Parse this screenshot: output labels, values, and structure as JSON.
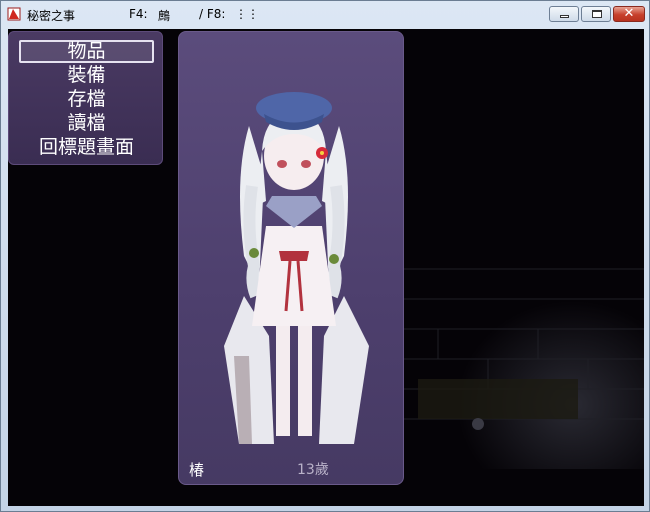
{
  "window": {
    "title": "秘密之事",
    "f4_label": "F4:",
    "f4_value": "鷓",
    "f8_label": "/ F8:",
    "f8_value": "⋮⋮",
    "icon": "app-game-icon",
    "buttons": [
      "minimize-icon",
      "maximize-icon",
      "close-icon"
    ],
    "close_glyph": "✕"
  },
  "menu": {
    "items": [
      {
        "label": "物品"
      },
      {
        "label": "裝備"
      },
      {
        "label": "存檔"
      },
      {
        "label": "讀檔"
      },
      {
        "label": "回標題畫面"
      }
    ],
    "selected_index": 0
  },
  "status": {
    "name": "椿",
    "age": "13歲"
  },
  "colors": {
    "panel": "#4d3f6d",
    "background": "#050307",
    "title_bar": "#c9d6e6",
    "close_button": "#c7402c"
  }
}
